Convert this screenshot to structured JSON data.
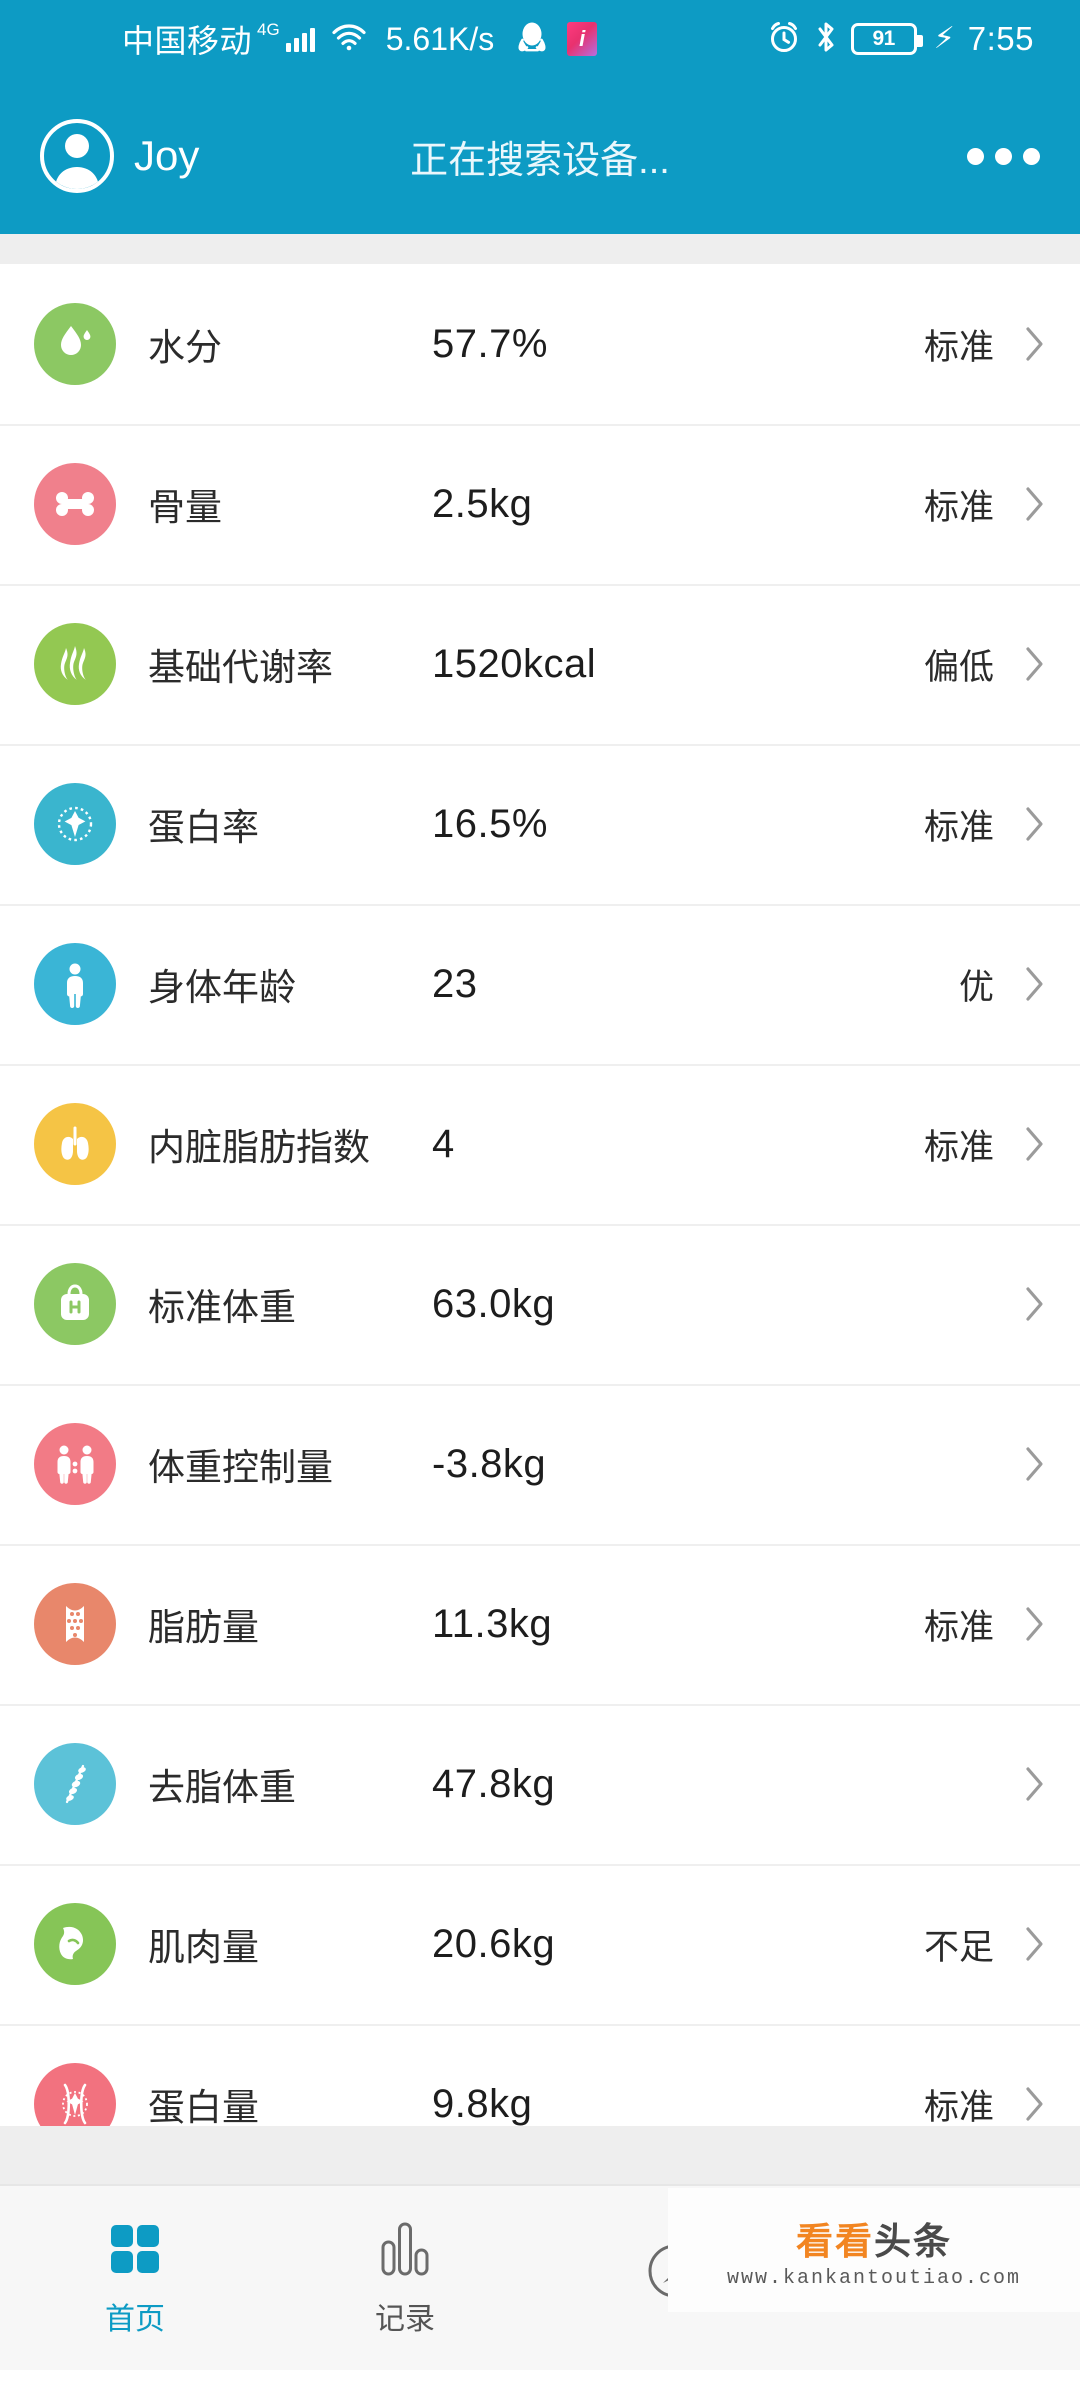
{
  "theme": {
    "accent": "#0d9bc4",
    "page_bg": "#ffffff",
    "divider": "#eeeeee"
  },
  "status_bar": {
    "carrier": "中国移动",
    "network_type": "4G",
    "signal_icon": "signal-bars-icon",
    "wifi_icon": "wifi-icon",
    "net_speed": "5.61K/s",
    "qq_icon": "qq-penguin-icon",
    "app_icon": "pink-app-icon",
    "alarm_icon": "alarm-clock-icon",
    "bluetooth_icon": "bluetooth-icon",
    "battery_level": "91",
    "charging_icon": "charging-bolt-icon",
    "clock": "7:55"
  },
  "header": {
    "avatar_icon": "user-avatar-icon",
    "username": "Joy",
    "title": "正在搜索设备...",
    "more_icon": "more-options-icon"
  },
  "list": {
    "chevron_icon": "chevron-right-icon",
    "rows": [
      {
        "icon": "water-drop-icon",
        "icon_color": "#8cc863",
        "label": "水分",
        "value": "57.7%",
        "status": "标准"
      },
      {
        "icon": "bone-icon",
        "icon_color": "#f0808c",
        "label": "骨量",
        "value": "2.5kg",
        "status": "标准"
      },
      {
        "icon": "flame-metabolism-icon",
        "icon_color": "#93c852",
        "label": "基础代谢率",
        "value": "1520kcal",
        "status": "偏低"
      },
      {
        "icon": "protein-cell-icon",
        "icon_color": "#3ab5ce",
        "label": "蛋白率",
        "value": "16.5%",
        "status": "标准"
      },
      {
        "icon": "body-figure-icon",
        "icon_color": "#3ab5d6",
        "label": "身体年龄",
        "value": "23",
        "status": "优"
      },
      {
        "icon": "lungs-visceral-icon",
        "icon_color": "#f5c445",
        "label": "内脏脂肪指数",
        "value": "4",
        "status": "标准"
      },
      {
        "icon": "scale-weight-icon",
        "icon_color": "#8cc863",
        "label": "标准体重",
        "value": "63.0kg",
        "status": ""
      },
      {
        "icon": "two-people-icon",
        "icon_color": "#f27b86",
        "label": "体重控制量",
        "value": "-3.8kg",
        "status": ""
      },
      {
        "icon": "fat-mass-icon",
        "icon_color": "#e8876b",
        "label": "脂肪量",
        "value": "11.3kg",
        "status": "标准"
      },
      {
        "icon": "spine-lean-icon",
        "icon_color": "#5cc2d8",
        "label": "去脂体重",
        "value": "47.8kg",
        "status": ""
      },
      {
        "icon": "muscle-arm-icon",
        "icon_color": "#86c557",
        "label": "肌肉量",
        "value": "20.6kg",
        "status": "不足"
      },
      {
        "icon": "protein-mass-icon",
        "icon_color": "#f2727f",
        "label": "蛋白量",
        "value": "9.8kg",
        "status": "标准"
      }
    ],
    "partial_row": {
      "icon": "bmi-icon",
      "icon_color": "#e8785c"
    }
  },
  "bottom_nav": {
    "items": [
      {
        "icon": "home-grid-icon",
        "label": "首页",
        "active": true
      },
      {
        "icon": "bar-chart-icon",
        "label": "记录",
        "active": false
      },
      {
        "icon": "compass-icon",
        "label": "",
        "active": false
      },
      {
        "icon": "profile-person-icon",
        "label": "",
        "active": false
      }
    ]
  },
  "watermark": {
    "cn_orange": "看看",
    "cn_dark": "头条",
    "url": "www.kankantoutiao.com"
  }
}
